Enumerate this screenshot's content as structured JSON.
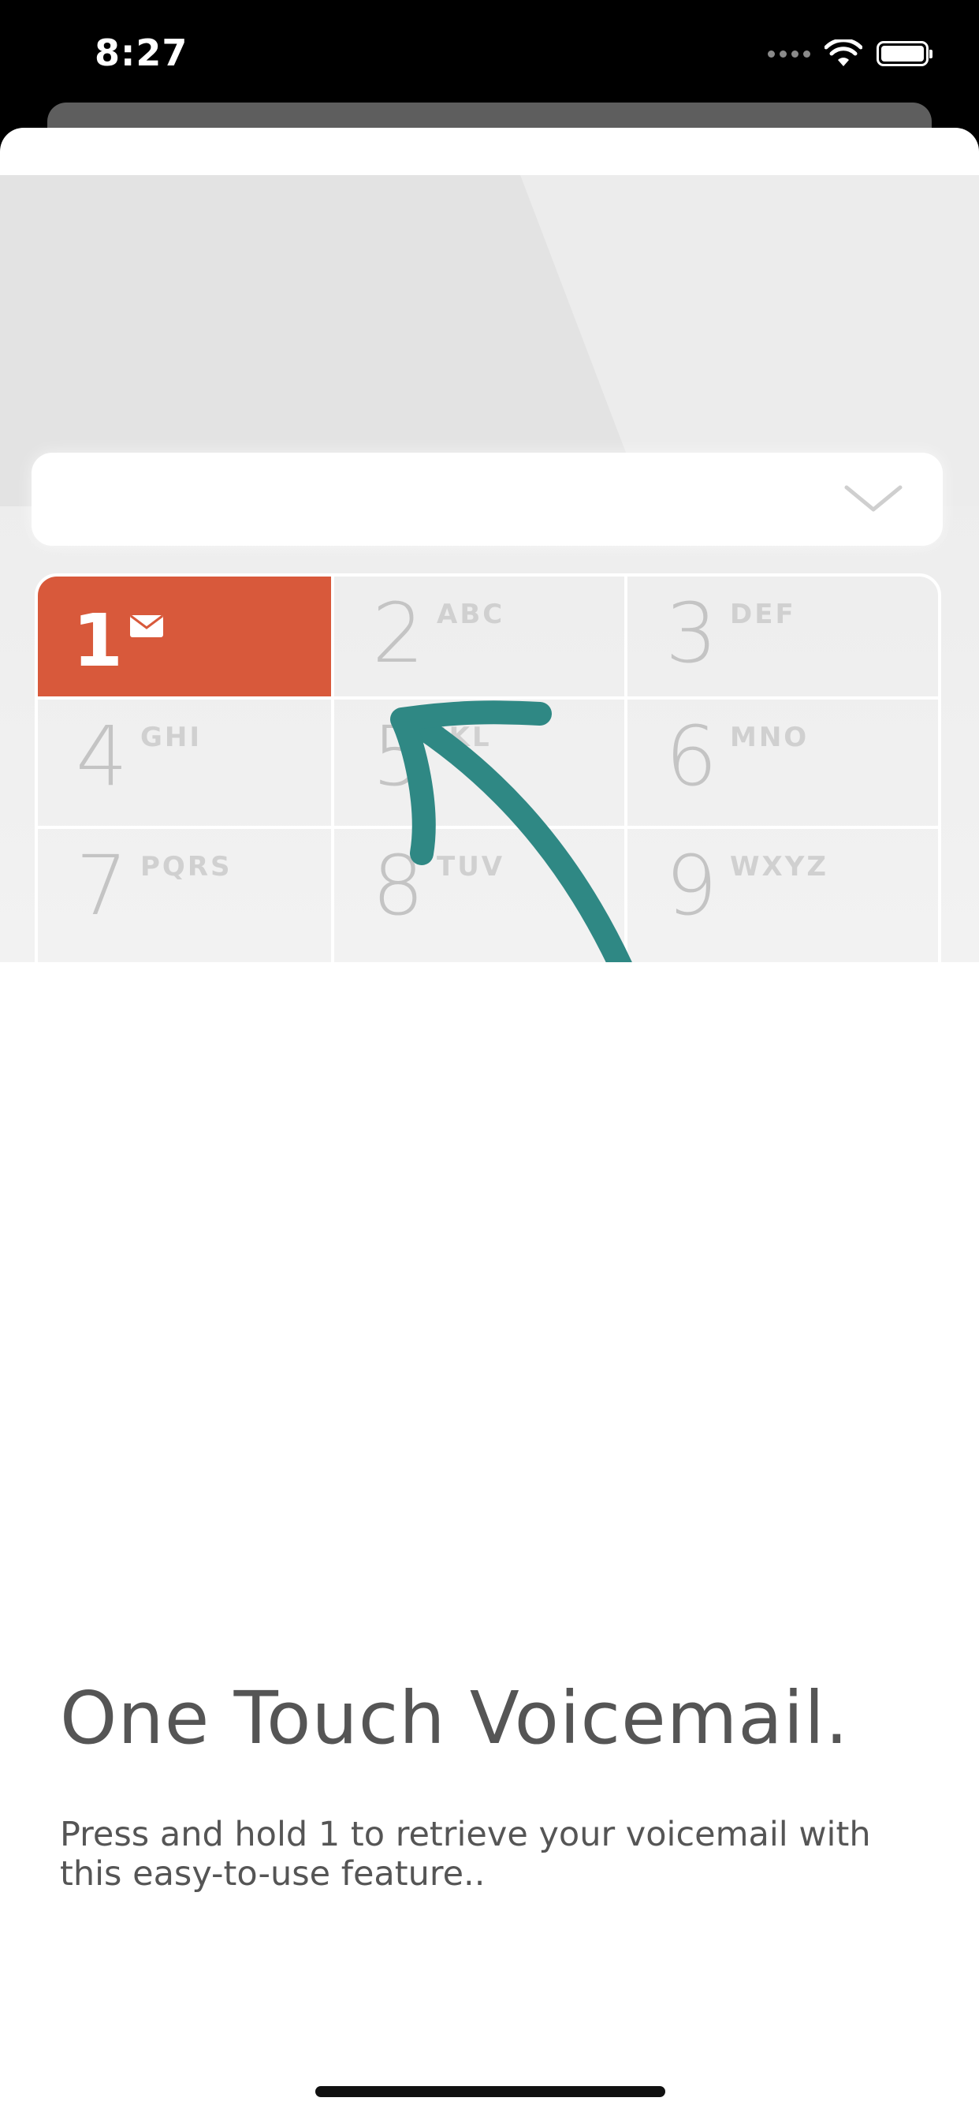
{
  "status_bar": {
    "time": "8:27"
  },
  "keypad": {
    "keys": [
      {
        "num": "1",
        "letters": ""
      },
      {
        "num": "2",
        "letters": "ABC"
      },
      {
        "num": "3",
        "letters": "DEF"
      },
      {
        "num": "4",
        "letters": "GHI"
      },
      {
        "num": "5",
        "letters": "JKL"
      },
      {
        "num": "6",
        "letters": "MNO"
      },
      {
        "num": "7",
        "letters": "PQRS"
      },
      {
        "num": "8",
        "letters": "TUV"
      },
      {
        "num": "9",
        "letters": "WXYZ"
      }
    ],
    "active_color": "#d8593b",
    "arrow_color": "#2f8884"
  },
  "onboarding": {
    "title": "One Touch Voicemail.",
    "body": "Press and hold 1 to retrieve your voicemail with this easy-to-use feature.."
  }
}
